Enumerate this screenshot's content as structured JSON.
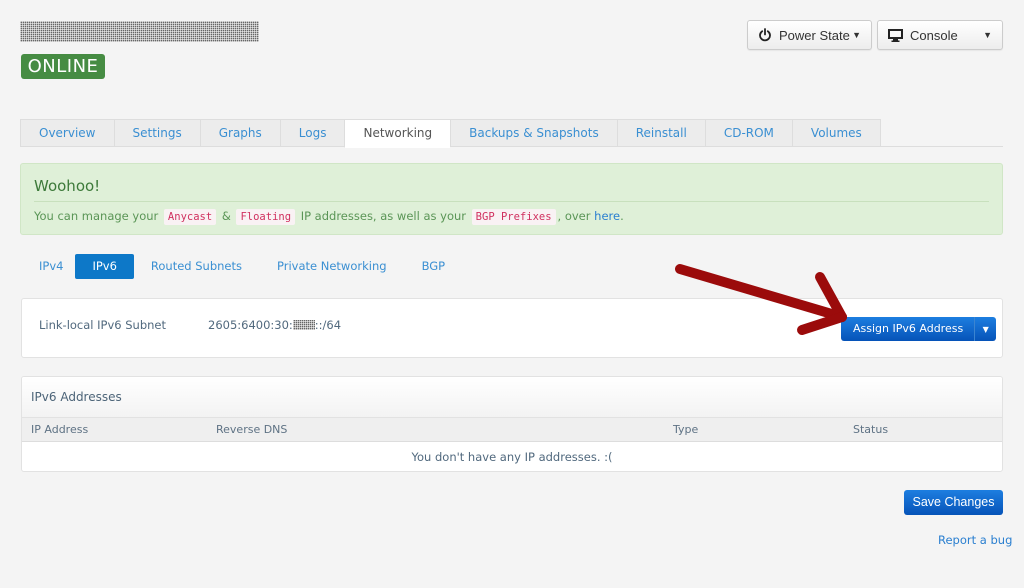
{
  "server": {
    "name_redacted": true,
    "status": "ONLINE",
    "status_color": "#468c43"
  },
  "header_buttons": {
    "power_state": {
      "label": "Power State",
      "icon": "power-icon"
    },
    "console": {
      "label": "Console",
      "icon": "monitor-icon"
    }
  },
  "main_tabs": [
    {
      "label": "Overview",
      "active": false
    },
    {
      "label": "Settings",
      "active": false
    },
    {
      "label": "Graphs",
      "active": false
    },
    {
      "label": "Logs",
      "active": false
    },
    {
      "label": "Networking",
      "active": true
    },
    {
      "label": "Backups & Snapshots",
      "active": false
    },
    {
      "label": "Reinstall",
      "active": false
    },
    {
      "label": "CD-ROM",
      "active": false
    },
    {
      "label": "Volumes",
      "active": false
    }
  ],
  "alert": {
    "title": "Woohoo!",
    "text_1": "You can manage your",
    "code_1": "Anycast",
    "text_2": "&",
    "code_2": "Floating",
    "text_3": "IP addresses, as well as your",
    "code_3": "BGP Prefixes",
    "text_4": ", over",
    "link": "here",
    "text_5": "."
  },
  "sub_tabs": [
    {
      "label": "IPv4",
      "active": false
    },
    {
      "label": "IPv6",
      "active": true
    },
    {
      "label": "Routed Subnets",
      "active": false
    },
    {
      "label": "Private Networking",
      "active": false
    },
    {
      "label": "BGP",
      "active": false
    }
  ],
  "subnet": {
    "label": "Link-local IPv6 Subnet",
    "value_prefix": "2605:6400:30:",
    "value_suffix": "::/64",
    "assign_button": "Assign IPv6 Address"
  },
  "addresses_panel": {
    "title": "IPv6 Addresses",
    "columns": [
      "IP Address",
      "Reverse DNS",
      "Type",
      "Status"
    ],
    "rows": [],
    "empty_message": "You don't have any IP addresses. :("
  },
  "footer": {
    "save_label": "Save Changes",
    "report_label": "Report a bug"
  },
  "annotation": {
    "arrow_color": "#9b0b0b",
    "points_to": "Assign IPv6 Address"
  }
}
